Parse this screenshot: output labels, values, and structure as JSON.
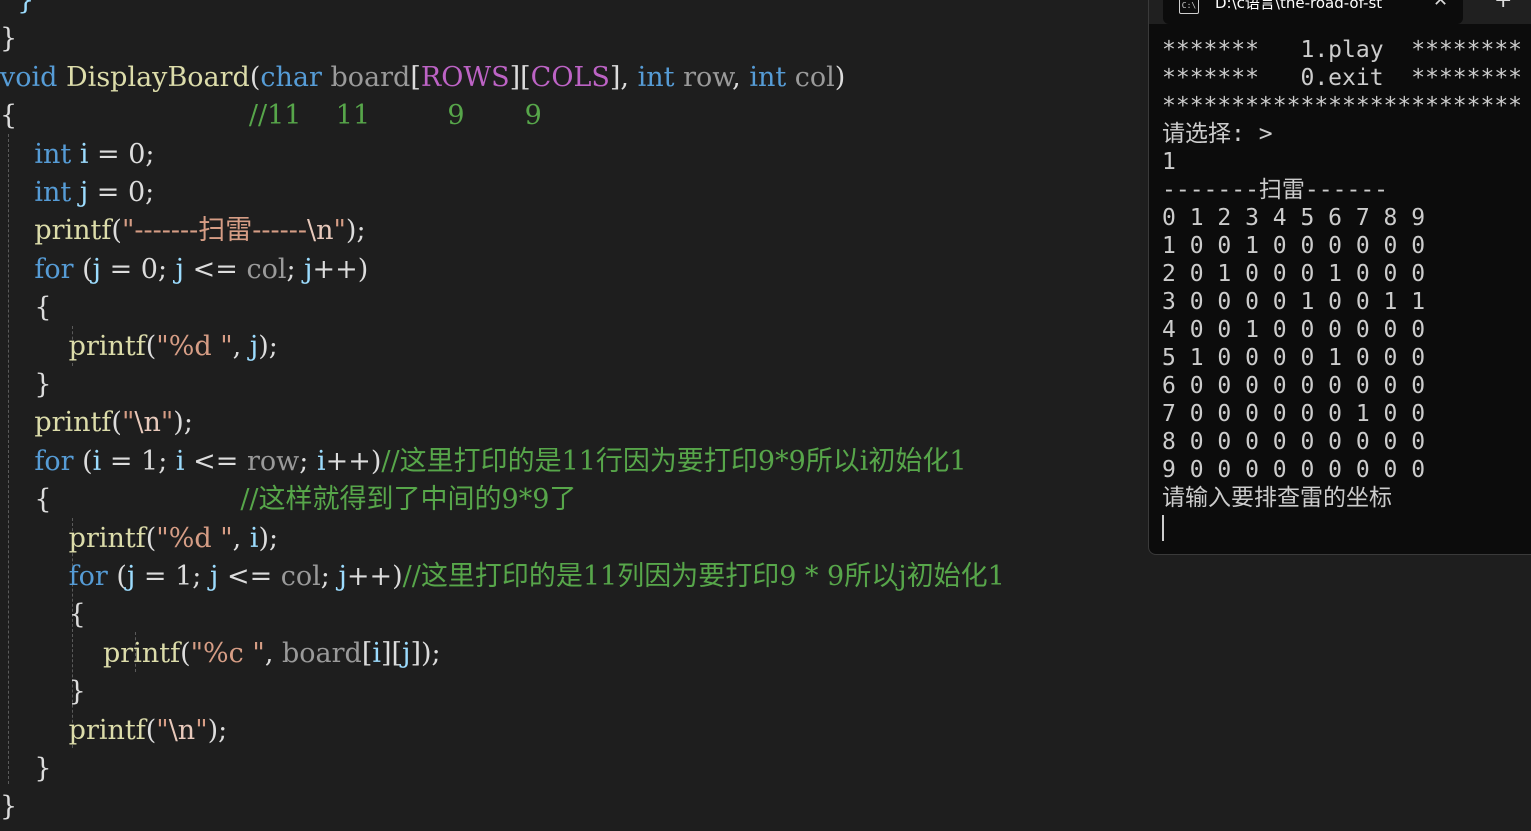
{
  "editor": {
    "lines": [
      {
        "parts": [
          {
            "t": "  }",
            "c": "id"
          }
        ]
      },
      {
        "parts": [
          {
            "t": "}",
            "c": ""
          }
        ]
      },
      {
        "parts": [
          {
            "t": "void",
            "c": "kw"
          },
          {
            "t": " ",
            "c": ""
          },
          {
            "t": "DisplayBoard",
            "c": "fn"
          },
          {
            "t": "(",
            "c": ""
          },
          {
            "t": "char",
            "c": "kw"
          },
          {
            "t": " ",
            "c": ""
          },
          {
            "t": "board",
            "c": "par"
          },
          {
            "t": "[",
            "c": ""
          },
          {
            "t": "ROWS",
            "c": "mac"
          },
          {
            "t": "][",
            "c": ""
          },
          {
            "t": "COLS",
            "c": "mac"
          },
          {
            "t": "], ",
            "c": ""
          },
          {
            "t": "int",
            "c": "kw"
          },
          {
            "t": " ",
            "c": ""
          },
          {
            "t": "row",
            "c": "par"
          },
          {
            "t": ", ",
            "c": ""
          },
          {
            "t": "int",
            "c": "kw"
          },
          {
            "t": " ",
            "c": ""
          },
          {
            "t": "col",
            "c": "par"
          },
          {
            "t": ")",
            "c": ""
          }
        ]
      },
      {
        "parts": [
          {
            "t": "{",
            "c": ""
          },
          {
            "t": "                           //11    11         9       9",
            "c": "cmt"
          }
        ]
      },
      {
        "parts": [
          {
            "t": "    ",
            "c": ""
          },
          {
            "t": "int",
            "c": "kw"
          },
          {
            "t": " ",
            "c": ""
          },
          {
            "t": "i",
            "c": "id"
          },
          {
            "t": " = 0;",
            "c": ""
          }
        ]
      },
      {
        "parts": [
          {
            "t": "    ",
            "c": ""
          },
          {
            "t": "int",
            "c": "kw"
          },
          {
            "t": " ",
            "c": ""
          },
          {
            "t": "j",
            "c": "id"
          },
          {
            "t": " = 0;",
            "c": ""
          }
        ]
      },
      {
        "parts": [
          {
            "t": "    ",
            "c": ""
          },
          {
            "t": "printf",
            "c": "fn"
          },
          {
            "t": "(",
            "c": ""
          },
          {
            "t": "\"-------扫雷------",
            "c": "str"
          },
          {
            "t": "\\n",
            "c": "esc"
          },
          {
            "t": "\"",
            "c": "str"
          },
          {
            "t": ");",
            "c": ""
          }
        ]
      },
      {
        "parts": [
          {
            "t": "    ",
            "c": ""
          },
          {
            "t": "for",
            "c": "kw"
          },
          {
            "t": " (",
            "c": ""
          },
          {
            "t": "j",
            "c": "id"
          },
          {
            "t": " = 0; ",
            "c": ""
          },
          {
            "t": "j",
            "c": "id"
          },
          {
            "t": " <= ",
            "c": ""
          },
          {
            "t": "col",
            "c": "par"
          },
          {
            "t": "; ",
            "c": ""
          },
          {
            "t": "j",
            "c": "id"
          },
          {
            "t": "++)",
            "c": ""
          }
        ]
      },
      {
        "parts": [
          {
            "t": "    {",
            "c": ""
          }
        ]
      },
      {
        "parts": [
          {
            "t": "        ",
            "c": ""
          },
          {
            "t": "printf",
            "c": "fn"
          },
          {
            "t": "(",
            "c": ""
          },
          {
            "t": "\"%d \"",
            "c": "str"
          },
          {
            "t": ", ",
            "c": ""
          },
          {
            "t": "j",
            "c": "id"
          },
          {
            "t": ");",
            "c": ""
          }
        ]
      },
      {
        "parts": [
          {
            "t": "    }",
            "c": ""
          }
        ]
      },
      {
        "parts": [
          {
            "t": "    ",
            "c": ""
          },
          {
            "t": "printf",
            "c": "fn"
          },
          {
            "t": "(",
            "c": ""
          },
          {
            "t": "\"",
            "c": "str"
          },
          {
            "t": "\\n",
            "c": "esc"
          },
          {
            "t": "\"",
            "c": "str"
          },
          {
            "t": ");",
            "c": ""
          }
        ]
      },
      {
        "parts": [
          {
            "t": "    ",
            "c": ""
          },
          {
            "t": "for",
            "c": "kw"
          },
          {
            "t": " (",
            "c": ""
          },
          {
            "t": "i",
            "c": "id"
          },
          {
            "t": " = 1; ",
            "c": ""
          },
          {
            "t": "i",
            "c": "id"
          },
          {
            "t": " <= ",
            "c": ""
          },
          {
            "t": "row",
            "c": "par"
          },
          {
            "t": "; ",
            "c": ""
          },
          {
            "t": "i",
            "c": "id"
          },
          {
            "t": "++)",
            "c": ""
          },
          {
            "t": "//这里打印的是11行因为要打印9*9所以i初始化1",
            "c": "cmt"
          }
        ]
      },
      {
        "parts": [
          {
            "t": "    {",
            "c": ""
          },
          {
            "t": "                      //这样就得到了中间的9*9了",
            "c": "cmt"
          }
        ]
      },
      {
        "parts": [
          {
            "t": "        ",
            "c": ""
          },
          {
            "t": "printf",
            "c": "fn"
          },
          {
            "t": "(",
            "c": ""
          },
          {
            "t": "\"%d \"",
            "c": "str"
          },
          {
            "t": ", ",
            "c": ""
          },
          {
            "t": "i",
            "c": "id"
          },
          {
            "t": ");",
            "c": ""
          }
        ]
      },
      {
        "parts": [
          {
            "t": "        ",
            "c": ""
          },
          {
            "t": "for",
            "c": "kw"
          },
          {
            "t": " (",
            "c": ""
          },
          {
            "t": "j",
            "c": "id"
          },
          {
            "t": " = 1; ",
            "c": ""
          },
          {
            "t": "j",
            "c": "id"
          },
          {
            "t": " <= ",
            "c": ""
          },
          {
            "t": "col",
            "c": "par"
          },
          {
            "t": "; ",
            "c": ""
          },
          {
            "t": "j",
            "c": "id"
          },
          {
            "t": "++)",
            "c": ""
          },
          {
            "t": "//这里打印的是11列因为要打印9 * 9所以j初始化1",
            "c": "cmt"
          }
        ]
      },
      {
        "parts": [
          {
            "t": "        {",
            "c": ""
          }
        ]
      },
      {
        "parts": [
          {
            "t": "            ",
            "c": ""
          },
          {
            "t": "printf",
            "c": "fn"
          },
          {
            "t": "(",
            "c": ""
          },
          {
            "t": "\"%c \"",
            "c": "str"
          },
          {
            "t": ", ",
            "c": ""
          },
          {
            "t": "board",
            "c": "par"
          },
          {
            "t": "[",
            "c": ""
          },
          {
            "t": "i",
            "c": "id"
          },
          {
            "t": "][",
            "c": ""
          },
          {
            "t": "j",
            "c": "id"
          },
          {
            "t": "]);",
            "c": ""
          }
        ]
      },
      {
        "parts": [
          {
            "t": "        }",
            "c": ""
          }
        ]
      },
      {
        "parts": [
          {
            "t": "        ",
            "c": ""
          },
          {
            "t": "printf",
            "c": "fn"
          },
          {
            "t": "(",
            "c": ""
          },
          {
            "t": "\"",
            "c": "str"
          },
          {
            "t": "\\n",
            "c": "esc"
          },
          {
            "t": "\"",
            "c": "str"
          },
          {
            "t": ");",
            "c": ""
          }
        ]
      },
      {
        "parts": [
          {
            "t": "    }",
            "c": ""
          }
        ]
      },
      {
        "parts": [
          {
            "t": "}",
            "c": ""
          }
        ]
      }
    ]
  },
  "terminal": {
    "tab_title": "D:\\c语言\\the-road-of-st",
    "tab_icon": "C:\\",
    "close_glyph": "✕",
    "new_tab_glyph": "+",
    "lines": [
      "*******   1.play  ********",
      "*******   0.exit  ********",
      "**************************",
      "请选择: >",
      "1",
      "-------扫雷------",
      "0 1 2 3 4 5 6 7 8 9",
      "1 0 0 1 0 0 0 0 0 0",
      "2 0 1 0 0 0 1 0 0 0",
      "3 0 0 0 0 1 0 0 1 1",
      "4 0 0 1 0 0 0 0 0 0",
      "5 1 0 0 0 0 1 0 0 0",
      "6 0 0 0 0 0 0 0 0 0",
      "7 0 0 0 0 0 0 1 0 0",
      "8 0 0 0 0 0 0 0 0 0",
      "9 0 0 0 0 0 0 0 0 0",
      "请输入要排查雷的坐标"
    ]
  }
}
